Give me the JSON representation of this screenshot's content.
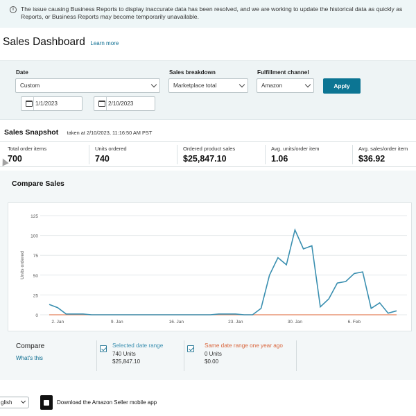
{
  "banner": {
    "icon": "info-icon",
    "text": "The issue causing Business Reports to display inaccurate data has been resolved, and we are working to update the historical data as quickly as",
    "text2": "Reports, or Business Reports may become temporarily unavailable."
  },
  "header": {
    "title": "Sales Dashboard",
    "learn_more": "Learn more"
  },
  "filters": {
    "date_label": "Date",
    "date_value": "Custom",
    "start_date": "1/1/2023",
    "end_date": "2/10/2023",
    "breakdown_label": "Sales breakdown",
    "breakdown_value": "Marketplace total",
    "fulfillment_label": "Fulfillment channel",
    "fulfillment_value": "Amazon",
    "apply_label": "Apply"
  },
  "snapshot": {
    "title": "Sales Snapshot",
    "taken_at": "taken at 2/10/2023, 11:16:50 AM PST",
    "metrics": [
      {
        "label": "Total order items",
        "value": "700"
      },
      {
        "label": "Units ordered",
        "value": "740"
      },
      {
        "label": "Ordered product sales",
        "value": "$25,847.10"
      },
      {
        "label": "Avg. units/order item",
        "value": "1.06"
      },
      {
        "label": "Avg. sales/order item",
        "value": "$36.92"
      }
    ]
  },
  "compare": {
    "title": "Compare Sales",
    "compare_label": "Compare",
    "whats_this": "What's this",
    "selected": {
      "title": "Selected date range",
      "units": "740 Units",
      "sales": "$25,847.10",
      "checked": true
    },
    "last_year": {
      "title": "Same date range one year ago",
      "units": "0 Units",
      "sales": "$0.00",
      "checked": true
    }
  },
  "chart_data": {
    "type": "line",
    "ylabel": "Units ordered",
    "ylim": [
      0,
      125
    ],
    "yticks": [
      0,
      25,
      50,
      75,
      100,
      125
    ],
    "xticks": [
      "2. Jan",
      "9. Jan",
      "16. Jan",
      "23. Jan",
      "30. Jan",
      "6. Feb"
    ],
    "x": [
      "Jan 1",
      "Jan 2",
      "Jan 3",
      "Jan 4",
      "Jan 5",
      "Jan 6",
      "Jan 7",
      "Jan 8",
      "Jan 9",
      "Jan 10",
      "Jan 11",
      "Jan 12",
      "Jan 13",
      "Jan 14",
      "Jan 15",
      "Jan 16",
      "Jan 17",
      "Jan 18",
      "Jan 19",
      "Jan 20",
      "Jan 21",
      "Jan 22",
      "Jan 23",
      "Jan 24",
      "Jan 25",
      "Jan 26",
      "Jan 27",
      "Jan 28",
      "Jan 29",
      "Jan 30",
      "Jan 31",
      "Feb 1",
      "Feb 2",
      "Feb 3",
      "Feb 4",
      "Feb 5",
      "Feb 6",
      "Feb 7",
      "Feb 8",
      "Feb 9",
      "Feb 10"
    ],
    "series": [
      {
        "name": "Selected date range",
        "color": "#3a8fb0",
        "values": [
          13,
          9,
          1,
          1,
          1,
          0,
          0,
          0,
          0,
          0,
          0,
          0,
          0,
          0,
          0,
          0,
          0,
          0,
          0,
          0,
          1,
          1,
          1,
          0,
          0,
          8,
          50,
          72,
          63,
          107,
          83,
          87,
          10,
          20,
          40,
          42,
          52,
          54,
          8,
          15,
          2,
          5
        ]
      },
      {
        "name": "Same date range one year ago",
        "color": "#e4805a",
        "values": [
          0,
          0,
          0,
          0,
          0,
          0,
          0,
          0,
          0,
          0,
          0,
          0,
          0,
          0,
          0,
          0,
          0,
          0,
          0,
          0,
          0,
          0,
          0,
          0,
          0,
          0,
          0,
          0,
          0,
          0,
          0,
          0,
          0,
          0,
          0,
          0,
          0,
          0,
          0,
          0,
          0,
          0
        ]
      }
    ]
  },
  "footer": {
    "language": "glish",
    "app_link": "Download the Amazon Seller mobile app"
  },
  "colors": {
    "accent": "#0c7593",
    "link": "#0a6b8f",
    "last_year": "#d9643a",
    "selected": "#3a8fb0"
  }
}
